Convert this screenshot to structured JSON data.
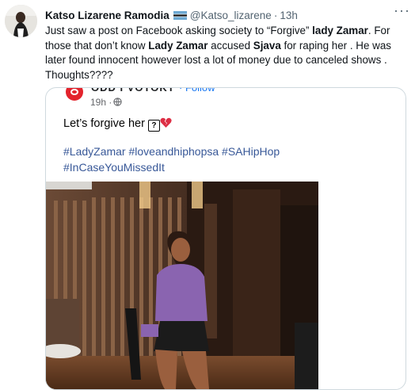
{
  "tweet": {
    "author_name": "Katso Lizarene Ramodia",
    "handle": "@Katso_lizarene",
    "separator": "·",
    "time": "13h",
    "more_icon": "more-horizontal-icon",
    "text": {
      "p1": "Just saw a post on Facebook asking society to “Forgive” ",
      "b1": "lady Zamar",
      "p2": ". For those that don’t know ",
      "b2": "Lady Zamar",
      "p3": " accused ",
      "b3": "Sjava",
      "p4": " for raping her . He was later found innocent however lost a lot of money due to canceled shows . Thoughts????"
    }
  },
  "embedded_post": {
    "page_name": "ODD I VOTOKT",
    "follow_label": "· Follow",
    "time": "19h ·",
    "text": "Let’s forgive her",
    "question_glyph": "?",
    "hashtags_line1": "#LadyZamar #loveandhiphopsa #SAHipHop",
    "hashtags_line2": "#InCaseYouMissedIt"
  },
  "colors": {
    "text_primary": "#0f1419",
    "text_secondary": "#536471",
    "hashtag": "#385898",
    "card_border": "#cfd9de",
    "brand_red": "#e3232c"
  }
}
